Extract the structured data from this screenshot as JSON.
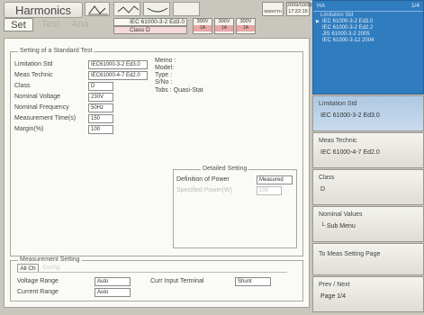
{
  "header": {
    "title": "Harmonics",
    "modes": [
      "Set",
      "Test",
      "Ana"
    ],
    "icon1_label": "Hmn",
    "icon2_label": "Fluk",
    "mini_label": "SMOOTH",
    "std_value": "IEC 61000-3-2 Ed3.0",
    "class_value": "Class D",
    "ranges": [
      {
        "top": "300V",
        "bottom": "1A"
      },
      {
        "top": "300V",
        "bottom": "1A"
      },
      {
        "top": "300V",
        "bottom": "1A"
      }
    ],
    "date": "2009/03/09",
    "time": "17:22:15"
  },
  "standard_group": {
    "title": "Setting of a Standard Test",
    "fields": [
      {
        "label": "Limitation Std",
        "value": "IEC61000-3-2 Ed3.0"
      },
      {
        "label": "Meas Technic",
        "value": "IEC61000-4-7 Ed2.0"
      },
      {
        "label": "Class",
        "value": "D"
      },
      {
        "label": "Nominal Voltage",
        "value": "230V"
      },
      {
        "label": "Nominal Frequency",
        "value": "50Hz"
      },
      {
        "label": "Measurement Time(s)",
        "value": "150"
      },
      {
        "label": "Margin(%)",
        "value": "100"
      }
    ],
    "memo": [
      "Memo :",
      "Model:",
      "Type :",
      "S/No :",
      "Tobs : Quasi-Stat"
    ]
  },
  "detailed_group": {
    "title": "Detailed Setting",
    "def_power_label": "Definition of Power",
    "def_power_value": "Measured",
    "spec_power_label": "Specified Power(W)",
    "spec_power_value": "100"
  },
  "measurement_group": {
    "title": "Measurement Setting",
    "tab_active": "All Ch",
    "tab_inactive": "Config",
    "voltage_range_label": "Voltage Range",
    "voltage_range_value": "Auto",
    "current_range_label": "Current Range",
    "current_range_value": "Auto",
    "curr_input_label": "Curr Input Terminal",
    "curr_input_value": "Shunt"
  },
  "right": {
    "list_title": "HA",
    "list_page": "1/4",
    "list_subtitle": "Limitation Std",
    "list_items": [
      "IEC 61000-3-2 Ed3.0",
      "IEC 61000-3-2 Ed2.2",
      "JIS 61000-3-2 2005",
      "IEC 61000-3-12 2004"
    ],
    "softkeys": [
      {
        "title": "Limitation Std",
        "value": "IEC 61000-3-2 Ed3.0"
      },
      {
        "title": "Meas Technic",
        "value": "IEC 61000-4-7 Ed2.0"
      },
      {
        "title": "Class",
        "value": "D"
      },
      {
        "title": "Nominal Values",
        "value": "└ Sub Menu"
      },
      {
        "title": "To Meas Setting Page",
        "value": ""
      },
      {
        "title": "Prev / Next",
        "value": "Page 1/4"
      }
    ]
  },
  "colors": {
    "accent": "#2f7cbf",
    "class_bg": "#f5d9d9",
    "range_bg": "#e9a6a6"
  }
}
